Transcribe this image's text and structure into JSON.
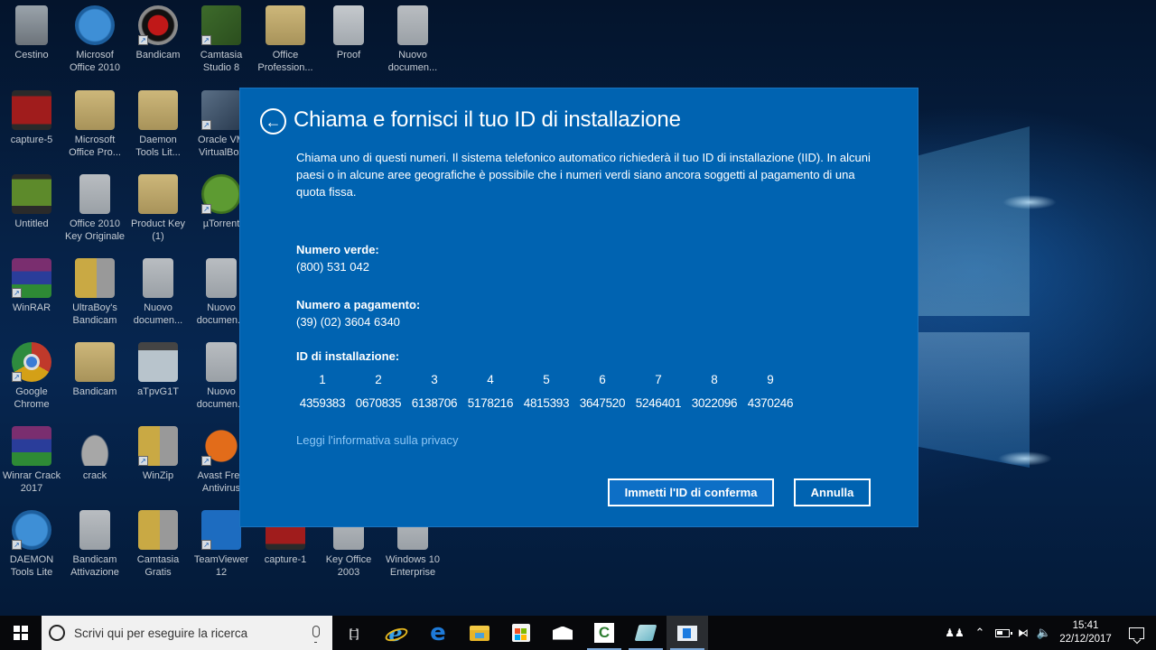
{
  "desktop": {
    "icons": [
      {
        "label": "Cestino",
        "icon": "recycle-bin-icon"
      },
      {
        "label": "Microsof Office 2010",
        "icon": "daemon-tools-icon"
      },
      {
        "label": "Bandicam",
        "icon": "bandicam-icon"
      },
      {
        "label": "Camtasia Studio 8",
        "icon": "camtasia-icon"
      },
      {
        "label": "Office Profession...",
        "icon": "folder-icon"
      },
      {
        "label": "Proof",
        "icon": "html-document-icon"
      },
      {
        "label": "Nuovo documen...",
        "icon": "text-document-icon"
      },
      {
        "label": "capture-5",
        "icon": "video-file-icon"
      },
      {
        "label": "Microsoft Office Pro...",
        "icon": "folder-icon"
      },
      {
        "label": "Daemon Tools Lit...",
        "icon": "folder-icon"
      },
      {
        "label": "Oracle VM VirtualBox",
        "icon": "virtualbox-icon"
      },
      {
        "label": "Untitled",
        "icon": "video-file-icon"
      },
      {
        "label": "Office 2010 Key Originale",
        "icon": "text-document-icon"
      },
      {
        "label": "Product Key (1)",
        "icon": "folder-icon"
      },
      {
        "label": "µTorrent",
        "icon": "utorrent-icon"
      },
      {
        "label": "WinRAR",
        "icon": "winrar-icon"
      },
      {
        "label": "UltraBoy's Bandicam",
        "icon": "archive-icon"
      },
      {
        "label": "Nuovo documen...",
        "icon": "text-document-icon"
      },
      {
        "label": "Nuovo documen...",
        "icon": "text-document-icon"
      },
      {
        "label": "Google Chrome",
        "icon": "chrome-icon"
      },
      {
        "label": "Bandicam",
        "icon": "folder-icon"
      },
      {
        "label": "aTpvG1T",
        "icon": "image-thumbnail-icon"
      },
      {
        "label": "Nuovo documen...",
        "icon": "text-document-icon"
      },
      {
        "label": "Winrar Crack 2017",
        "icon": "winrar-icon"
      },
      {
        "label": "crack",
        "icon": "hat-icon"
      },
      {
        "label": "WinZip",
        "icon": "winzip-icon"
      },
      {
        "label": "Avast Free Antivirus",
        "icon": "avast-icon"
      },
      {
        "label": "DAEMON Tools Lite",
        "icon": "daemon-tools-icon"
      },
      {
        "label": "Bandicam Attivazione",
        "icon": "text-document-icon"
      },
      {
        "label": "Camtasia Gratis",
        "icon": "archive-icon"
      },
      {
        "label": "TeamViewer 12",
        "icon": "teamviewer-icon"
      },
      {
        "label": "capture-1",
        "icon": "video-file-icon"
      },
      {
        "label": "Key Office 2003",
        "icon": "text-document-icon"
      },
      {
        "label": "Windows 10 Enterprise",
        "icon": "text-document-icon"
      }
    ]
  },
  "dialog": {
    "title": "Chiama e fornisci il tuo ID di installazione",
    "description": "Chiama uno di questi numeri. Il sistema telefonico automatico richiederà il tuo ID di installazione (IID). In alcuni paesi o in alcune aree geografiche è possibile che i numeri verdi siano ancora soggetti al pagamento di una quota fissa.",
    "toll_free_label": "Numero verde:",
    "toll_free_number": "(800) 531 042",
    "paid_label": "Numero a pagamento:",
    "paid_number": "(39) (02) 3604 6340",
    "iid_label": "ID di installazione:",
    "iid_groups": [
      {
        "index": "1",
        "value": "4359383"
      },
      {
        "index": "2",
        "value": "0670835"
      },
      {
        "index": "3",
        "value": "6138706"
      },
      {
        "index": "4",
        "value": "5178216"
      },
      {
        "index": "5",
        "value": "4815393"
      },
      {
        "index": "6",
        "value": "3647520"
      },
      {
        "index": "7",
        "value": "5246401"
      },
      {
        "index": "8",
        "value": "3022096"
      },
      {
        "index": "9",
        "value": "4370246"
      }
    ],
    "privacy_link": "Leggi l'informativa sulla privacy",
    "confirm_button": "Immetti l'ID di conferma",
    "cancel_button": "Annulla",
    "accent_color": "#0063b1"
  },
  "taskbar": {
    "search_placeholder": "Scrivi qui per eseguire la ricerca",
    "pinned": [
      {
        "name": "task-view",
        "icon": "task-view-icon"
      },
      {
        "name": "internet-explorer",
        "icon": "internet-explorer-icon"
      },
      {
        "name": "edge",
        "icon": "edge-icon"
      },
      {
        "name": "file-explorer",
        "icon": "file-explorer-icon"
      },
      {
        "name": "store",
        "icon": "store-icon"
      },
      {
        "name": "mail",
        "icon": "mail-icon"
      },
      {
        "name": "camtasia",
        "icon": "camtasia-icon"
      },
      {
        "name": "sticky-notes",
        "icon": "notes-icon"
      },
      {
        "name": "activation-app",
        "icon": "app-window-icon"
      }
    ],
    "clock_time": "15:41",
    "clock_date": "22/12/2017"
  }
}
